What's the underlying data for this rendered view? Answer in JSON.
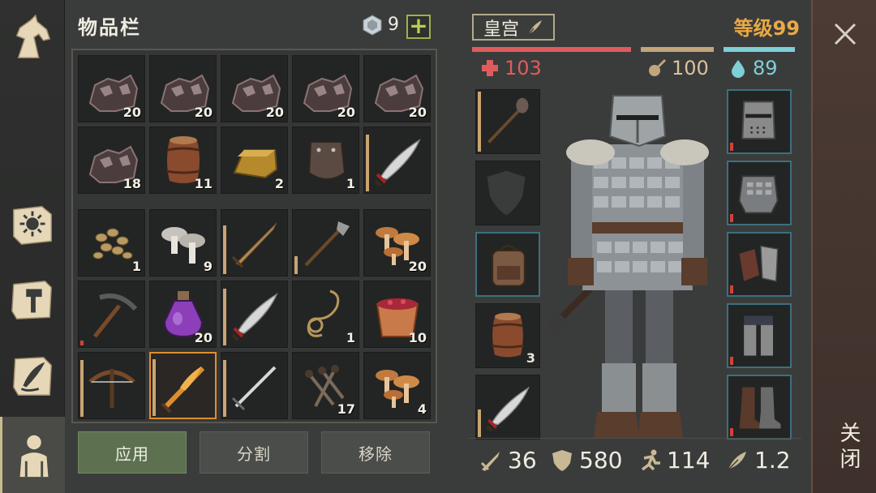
{
  "rail": {
    "items": [
      {
        "icon": "horse-icon"
      },
      {
        "icon": "sun-book-icon"
      },
      {
        "icon": "hammer-icon"
      },
      {
        "icon": "scroll-quill-icon"
      },
      {
        "icon": "character-icon",
        "active": true
      }
    ]
  },
  "inventory": {
    "title": "物品栏",
    "currency_count": "9",
    "add_label": "+",
    "top_slots": [
      {
        "icon": "ore-icon",
        "count": "20"
      },
      {
        "icon": "ore-icon",
        "count": "20"
      },
      {
        "icon": "ore-icon",
        "count": "20"
      },
      {
        "icon": "ore-icon",
        "count": "20"
      },
      {
        "icon": "ore-icon",
        "count": "20"
      },
      {
        "icon": "ore-icon",
        "count": "18"
      },
      {
        "icon": "barrel-icon",
        "count": "11"
      },
      {
        "icon": "ingot-icon",
        "count": "2"
      },
      {
        "icon": "armor-plate-icon",
        "count": "1"
      },
      {
        "icon": "scimitar-icon",
        "count": ""
      }
    ],
    "bottom_slots": [
      {
        "icon": "seeds-icon",
        "count": "1"
      },
      {
        "icon": "mushrooms-icon",
        "count": "9"
      },
      {
        "icon": "sword-icon",
        "count": ""
      },
      {
        "icon": "halberd-icon",
        "count": ""
      },
      {
        "icon": "orange-mushrooms-icon",
        "count": "20"
      },
      {
        "icon": "pickaxe-icon",
        "count": ""
      },
      {
        "icon": "potion-icon",
        "count": "20"
      },
      {
        "icon": "scimitar-icon",
        "count": ""
      },
      {
        "icon": "rope-icon",
        "count": "1"
      },
      {
        "icon": "berry-bucket-icon",
        "count": "10"
      },
      {
        "icon": "crossbow-icon",
        "count": ""
      },
      {
        "icon": "fire-sword-icon",
        "count": "",
        "selected": true
      },
      {
        "icon": "longsword-icon",
        "count": ""
      },
      {
        "icon": "nails-icon",
        "count": "17"
      },
      {
        "icon": "orange-mushrooms-icon",
        "count": "4"
      }
    ],
    "buttons": {
      "apply": "应用",
      "split": "分割",
      "remove": "移除"
    }
  },
  "character": {
    "location": "皇宫",
    "level": "等级99",
    "health": "103",
    "food": "100",
    "water": "89",
    "equip_left": [
      {
        "icon": "mace-icon",
        "count": ""
      },
      {
        "icon": "shield-placeholder-icon",
        "count": ""
      },
      {
        "icon": "backpack-icon",
        "count": ""
      },
      {
        "icon": "barrel-icon",
        "count": "3"
      },
      {
        "icon": "scimitar-icon",
        "count": ""
      }
    ],
    "equip_right": [
      {
        "icon": "great-helm-icon"
      },
      {
        "icon": "chainmail-icon"
      },
      {
        "icon": "gauntlets-icon"
      },
      {
        "icon": "leg-armor-icon"
      },
      {
        "icon": "boots-icon"
      }
    ],
    "attack": "36",
    "armor": "580",
    "speed": "114",
    "weight": "1.2"
  },
  "close": {
    "label": "关闭"
  },
  "colors": {
    "health": "#e05c5c",
    "food": "#c2a57a",
    "water": "#7fcfd6",
    "level": "#e9a946",
    "accent_select": "#e08d2e"
  }
}
